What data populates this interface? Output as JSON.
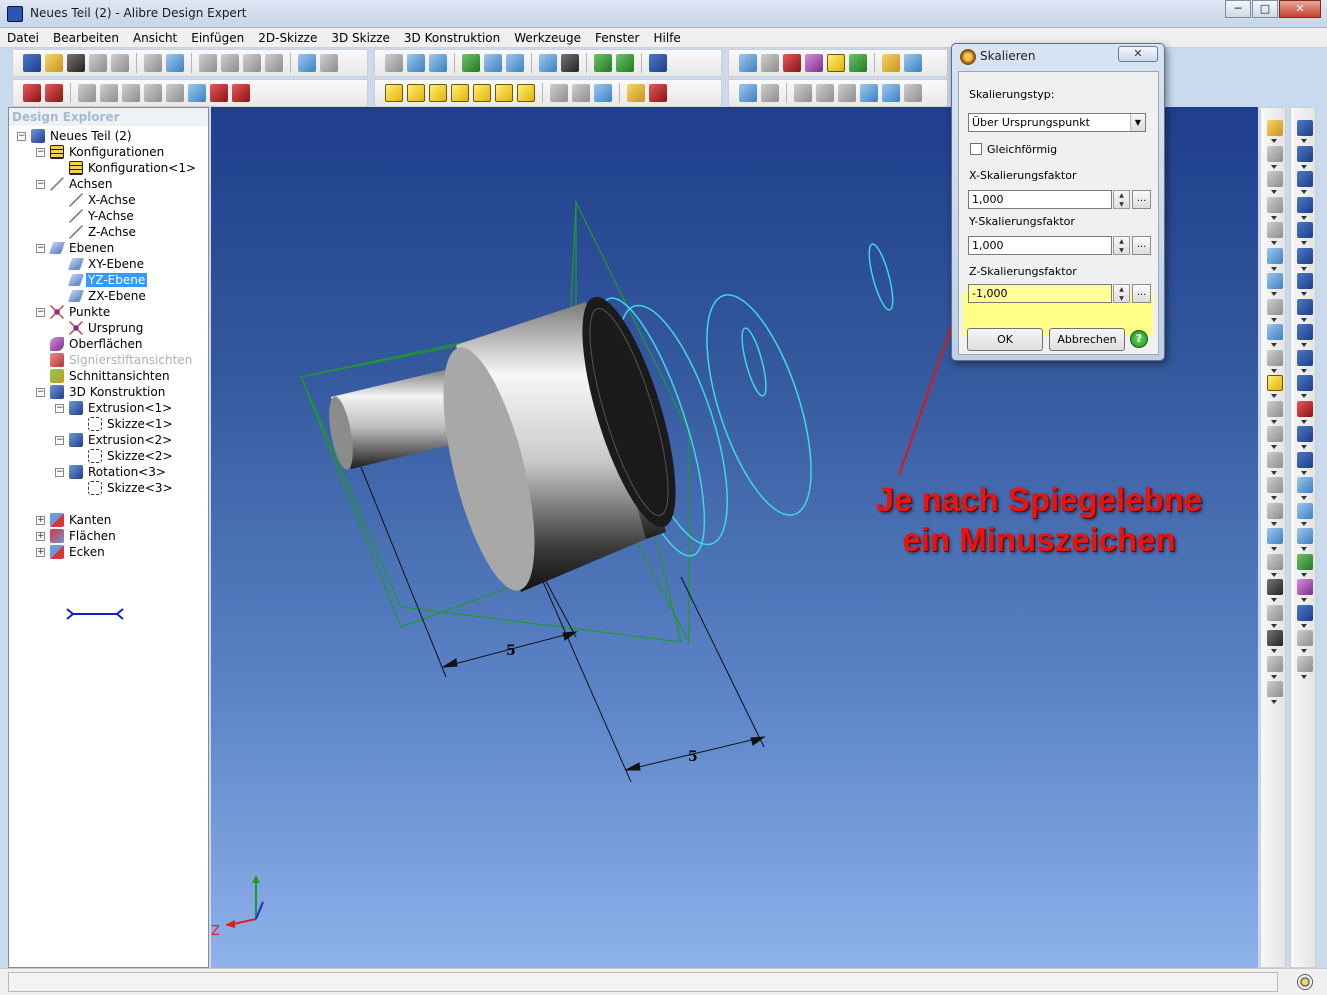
{
  "window": {
    "title": "Neues Teil (2) - Alibre Design Expert",
    "min": "─",
    "max": "□",
    "close": "✕"
  },
  "menu": [
    "Datei",
    "Bearbeiten",
    "Ansicht",
    "Einfügen",
    "2D-Skizze",
    "3D Skizze",
    "3D Konstruktion",
    "Werkzeuge",
    "Fenster",
    "Hilfe"
  ],
  "explorer": {
    "title": "Design Explorer",
    "items": [
      {
        "label": "Neues Teil (2)",
        "icon": "part-icon",
        "exp": "−",
        "level": 0
      },
      {
        "label": "Konfigurationen",
        "icon": "table-icon",
        "exp": "−",
        "level": 1
      },
      {
        "label": "Konfiguration<1>",
        "icon": "table-icon",
        "exp": "",
        "level": 2
      },
      {
        "label": "Achsen",
        "icon": "axis-icon",
        "exp": "−",
        "level": 1
      },
      {
        "label": "X-Achse",
        "icon": "axis-icon",
        "exp": "",
        "level": 2
      },
      {
        "label": "Y-Achse",
        "icon": "axis-icon",
        "exp": "",
        "level": 2
      },
      {
        "label": "Z-Achse",
        "icon": "axis-icon",
        "exp": "",
        "level": 2
      },
      {
        "label": "Ebenen",
        "icon": "plane-icon",
        "exp": "−",
        "level": 1
      },
      {
        "label": "XY-Ebene",
        "icon": "plane-icon",
        "exp": "",
        "level": 2
      },
      {
        "label": "YZ-Ebene",
        "icon": "plane-icon",
        "exp": "",
        "level": 2,
        "selected": true
      },
      {
        "label": "ZX-Ebene",
        "icon": "plane-icon",
        "exp": "",
        "level": 2
      },
      {
        "label": "Punkte",
        "icon": "point-icon",
        "exp": "−",
        "level": 1
      },
      {
        "label": "Ursprung",
        "icon": "point-icon",
        "exp": "",
        "level": 2
      },
      {
        "label": "Oberflächen",
        "icon": "surface-icon",
        "exp": "",
        "level": 1
      },
      {
        "label": "Signierstiftansichten",
        "icon": "sign-icon",
        "exp": "",
        "level": 1,
        "disabled": true
      },
      {
        "label": "Schnittansichten",
        "icon": "section-icon",
        "exp": "",
        "level": 1
      },
      {
        "label": "3D Konstruktion",
        "icon": "part-icon",
        "exp": "−",
        "level": 1
      },
      {
        "label": "Extrusion<1>",
        "icon": "part-icon",
        "exp": "−",
        "level": 2
      },
      {
        "label": "Skizze<1>",
        "icon": "sketch-icon",
        "exp": "",
        "level": 3
      },
      {
        "label": "Extrusion<2>",
        "icon": "part-icon",
        "exp": "−",
        "level": 2
      },
      {
        "label": "Skizze<2>",
        "icon": "sketch-icon",
        "exp": "",
        "level": 3
      },
      {
        "label": "Rotation<3>",
        "icon": "part-icon",
        "exp": "−",
        "level": 2
      },
      {
        "label": "Skizze<3>",
        "icon": "sketch-icon",
        "exp": "",
        "level": 3
      },
      {
        "label": "",
        "icon": "",
        "exp": "",
        "level": 0,
        "spacer": true
      },
      {
        "label": "Kanten",
        "icon": "edge-icon",
        "exp": "+",
        "level": 1
      },
      {
        "label": "Flächen",
        "icon": "face-icon",
        "exp": "+",
        "level": 1
      },
      {
        "label": "Ecken",
        "icon": "edge-icon",
        "exp": "+",
        "level": 1
      }
    ]
  },
  "viewport": {
    "dimension_1": "5",
    "dimension_2": "5",
    "triad_z": "Z"
  },
  "dialog": {
    "title": "Skalieren",
    "close": "✕",
    "type_label": "Skalierungstyp:",
    "type_value": "Über Ursprungspunkt",
    "uniform_label": "Gleichförmig",
    "uniform_checked": false,
    "x_label": "X-Skalierungsfaktor",
    "x_value": "1,000",
    "y_label": "Y-Skalierungsfaktor",
    "y_value": "1,000",
    "z_label": "Z-Skalierungsfaktor",
    "z_value": "-1,000",
    "dots": "...",
    "ok": "OK",
    "cancel": "Abbrechen",
    "help": "?"
  },
  "annotation": {
    "line1": "Je nach Spiegelebne",
    "line2": "ein Minuszeichen",
    "color": "#e8140e"
  },
  "colors": {
    "viewport_top": "#1f3e8c",
    "viewport_bottom": "#8fb2ea",
    "sketch_cyan": "#3fd6e8",
    "sketch_green": "#1f9a2a",
    "highlight_yellow": "#ffff88"
  }
}
